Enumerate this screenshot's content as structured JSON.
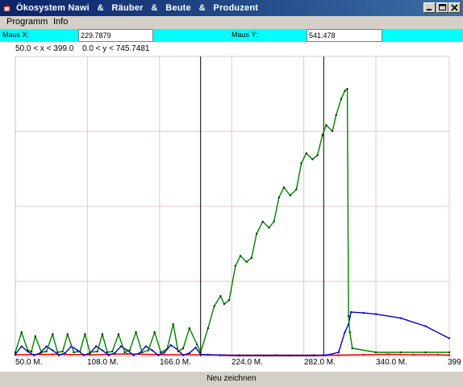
{
  "window": {
    "title": "Ökosystem Nawi   &   Räuber   &   Beute   &   Produzent"
  },
  "menu": {
    "items": [
      {
        "label": "Programm"
      },
      {
        "label": "Info"
      }
    ]
  },
  "mouse": {
    "x_label": "Maus X:",
    "x_value": "229.7879",
    "y_label": "Maus Y:",
    "y_value": "541.478"
  },
  "plot": {
    "x_range_text": "50.0 < x < 399.0",
    "y_range_text": "0.0 < y < 745.7481"
  },
  "bottom": {
    "button_label": "Neu zeichnen"
  },
  "colors": {
    "green": "#008000",
    "blue": "#0000c8",
    "red": "#e00000",
    "grid": "#e0c8c8",
    "cyan": "#00ffff"
  },
  "chart_data": {
    "type": "line",
    "xlim": [
      50.0,
      399.0
    ],
    "ylim": [
      0.0,
      745.7481
    ],
    "x_ticks": [
      "50.0 M.",
      "108.0 M.",
      "166.0 M.",
      "224.0 M.",
      "282.0 M.",
      "340.0 M.",
      "399"
    ],
    "x_tick_values": [
      50,
      108,
      166,
      224,
      282,
      340,
      399
    ],
    "markers_x": [
      199,
      298
    ],
    "series": [
      {
        "color": "green",
        "x": [
          50,
          55,
          60,
          63,
          66,
          71,
          75,
          80,
          84,
          88,
          92,
          97,
          102,
          106,
          110,
          116,
          120,
          124,
          128,
          133,
          138,
          142,
          147,
          152,
          157,
          162,
          167,
          172,
          177,
          181,
          185,
          190,
          196,
          199,
          205,
          210,
          215,
          218,
          222,
          227,
          231,
          236,
          240,
          244,
          249,
          254,
          258,
          262,
          266,
          271,
          276,
          280,
          284,
          289,
          293,
          297,
          300,
          305,
          308,
          312,
          315,
          317,
          318,
          319,
          321,
          340,
          360,
          380,
          399
        ],
        "y": [
          10,
          60,
          15,
          12,
          50,
          10,
          12,
          55,
          10,
          12,
          55,
          10,
          12,
          55,
          10,
          12,
          55,
          10,
          12,
          55,
          10,
          15,
          60,
          10,
          15,
          60,
          10,
          18,
          80,
          12,
          20,
          70,
          30,
          10,
          70,
          125,
          150,
          130,
          140,
          225,
          250,
          235,
          245,
          305,
          335,
          320,
          335,
          395,
          420,
          400,
          415,
          480,
          505,
          490,
          500,
          550,
          575,
          560,
          600,
          640,
          660,
          665,
          100,
          60,
          20,
          10,
          10,
          10,
          10
        ]
      },
      {
        "color": "blue",
        "x": [
          50,
          55,
          60,
          65,
          70,
          75,
          80,
          85,
          90,
          95,
          100,
          105,
          110,
          115,
          120,
          125,
          130,
          135,
          140,
          145,
          150,
          155,
          160,
          165,
          170,
          175,
          180,
          185,
          190,
          195,
          199,
          205,
          215,
          230,
          250,
          270,
          290,
          300,
          310,
          315,
          318,
          320,
          330,
          340,
          360,
          380,
          399
        ],
        "y": [
          5,
          25,
          12,
          3,
          8,
          25,
          15,
          3,
          8,
          25,
          15,
          3,
          8,
          25,
          15,
          3,
          8,
          25,
          15,
          3,
          8,
          25,
          15,
          3,
          10,
          28,
          18,
          3,
          8,
          22,
          5,
          4,
          3,
          2,
          2,
          2,
          2,
          3,
          10,
          60,
          80,
          110,
          108,
          105,
          95,
          75,
          45
        ]
      },
      {
        "color": "red",
        "x": [
          50,
          80,
          110,
          140,
          170,
          199,
          230,
          260,
          290,
          310,
          330,
          350,
          370,
          390,
          399
        ],
        "y": [
          4,
          5,
          4,
          6,
          4,
          4,
          3,
          3,
          3,
          3,
          4,
          5,
          4,
          4,
          3
        ]
      }
    ]
  }
}
